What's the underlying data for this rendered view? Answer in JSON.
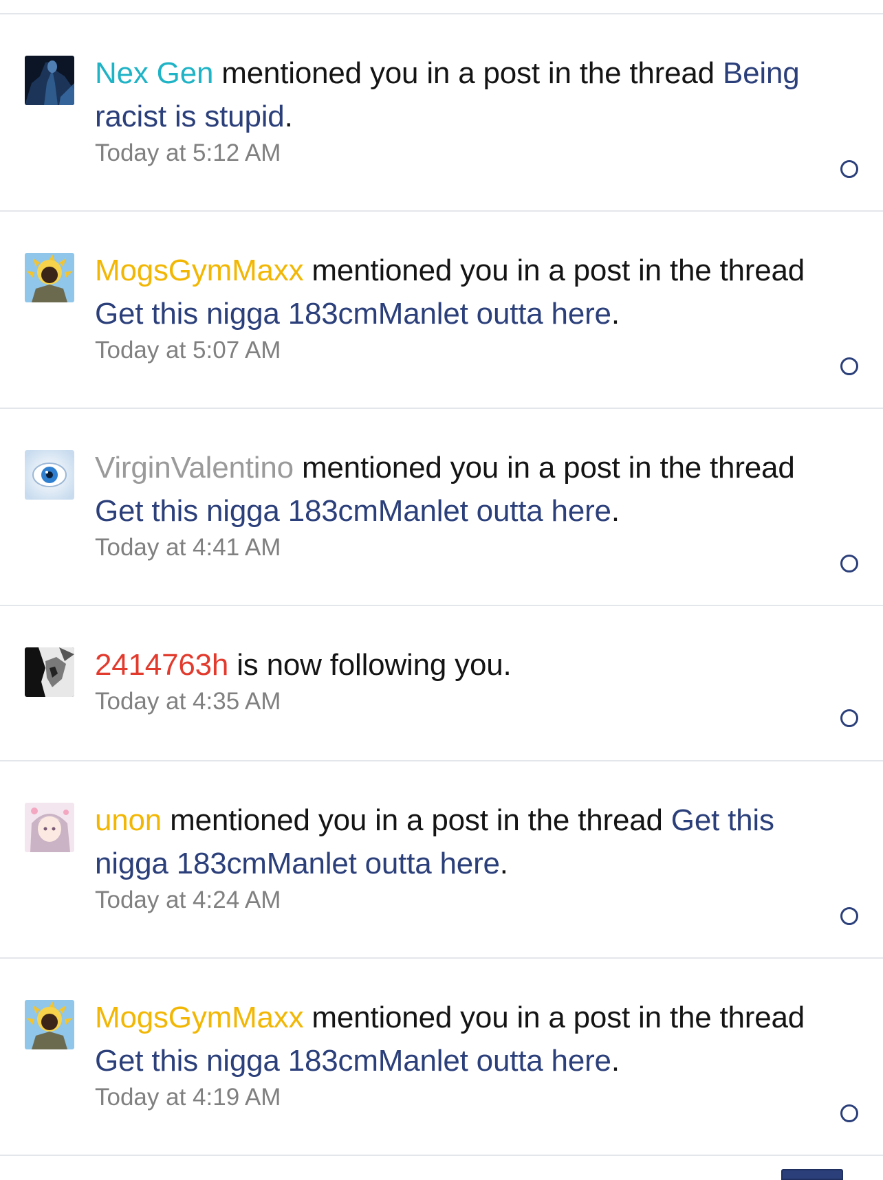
{
  "notifications": [
    {
      "user": "Nex Gen",
      "user_color": "#1fb3c6",
      "avatar_icon": "dark-figure-avatar-icon",
      "action": " mentioned you in a post in the thread ",
      "thread": "Being racist is stupid",
      "end": ".",
      "time": "Today at 5:12 AM"
    },
    {
      "user": "MogsGymMaxx",
      "user_color": "#f2b705",
      "avatar_icon": "sunburst-portrait-avatar-icon",
      "action": " mentioned you in a post in the thread ",
      "thread": "Get this nigga 183cmManlet outta here",
      "end": ".",
      "time": "Today at 5:07 AM"
    },
    {
      "user": "VirginValentino",
      "user_color": "#9a9a9a",
      "avatar_icon": "blue-eye-avatar-icon",
      "action": " mentioned you in a post in the thread ",
      "thread": "Get this nigga 183cmManlet outta here",
      "end": ".",
      "time": "Today at 4:41 AM"
    },
    {
      "user": "2414763h",
      "user_color": "#e23b2e",
      "avatar_icon": "grayscale-face-avatar-icon",
      "action": " is now following you.",
      "thread": "",
      "end": "",
      "time": "Today at 4:35 AM"
    },
    {
      "user": "unon",
      "user_color": "#f2b705",
      "avatar_icon": "anime-girl-avatar-icon",
      "action": " mentioned you in a post in the thread ",
      "thread": "Get this nigga 183cmManlet outta here",
      "end": ".",
      "time": "Today at 4:24 AM"
    },
    {
      "user": "MogsGymMaxx",
      "user_color": "#f2b705",
      "avatar_icon": "sunburst-portrait-avatar-icon",
      "action": " mentioned you in a post in the thread ",
      "thread": "Get this nigga 183cmManlet outta here",
      "end": ".",
      "time": "Today at 4:19 AM"
    }
  ],
  "read_toggle_icon": "mark-read-circle-icon",
  "colors": {
    "thread_link": "#2b3f7a",
    "timestamp": "#808080",
    "divider": "#e3e6ea"
  }
}
